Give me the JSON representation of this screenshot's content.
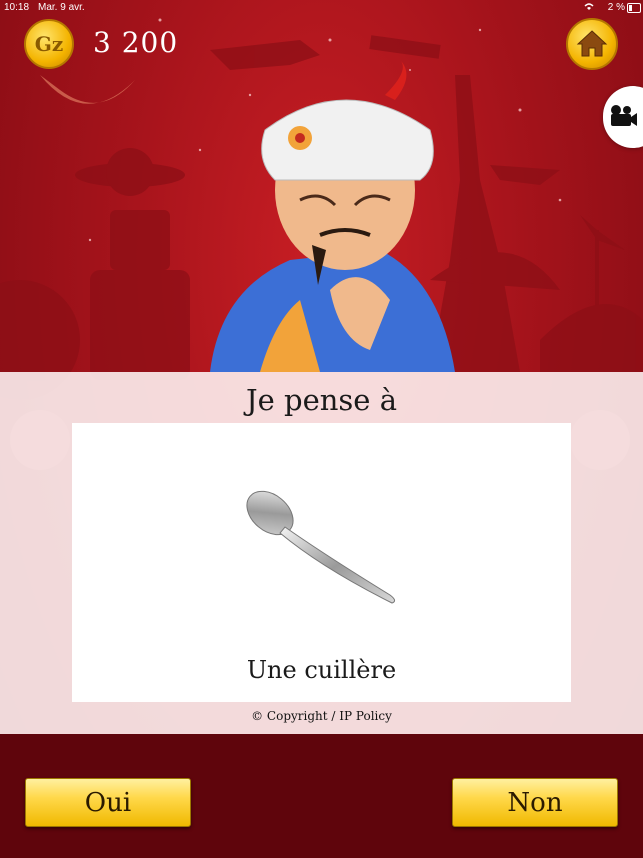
{
  "status_bar": {
    "time": "10:18",
    "date": "Mar. 9 avr.",
    "battery": "2 %"
  },
  "header": {
    "coin_label": "Gz",
    "score": "3 200"
  },
  "result": {
    "title": "Je pense à",
    "answer": "Une cuillère",
    "copyright": "© Copyright / IP Policy"
  },
  "buttons": {
    "yes": "Oui",
    "no": "Non"
  },
  "icons": {
    "home": "home-icon",
    "video": "video-camera-icon",
    "wifi": "wifi-icon",
    "battery": "battery-icon",
    "coin": "coin-icon"
  },
  "colors": {
    "background": "#b51620",
    "button": "#ffd84a",
    "bottom_bar": "#5f050c"
  }
}
